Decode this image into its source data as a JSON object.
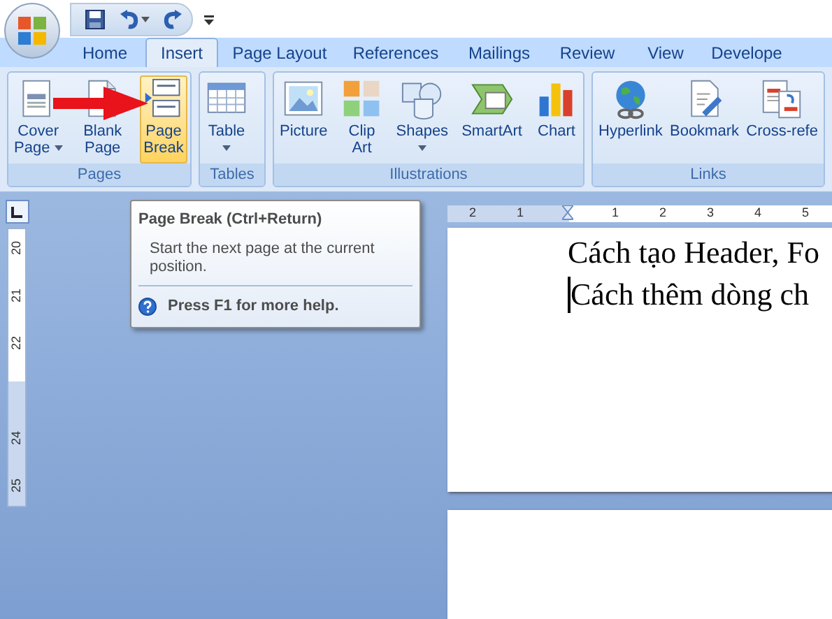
{
  "tabs": [
    {
      "label": "Home",
      "selected": false
    },
    {
      "label": "Insert",
      "selected": true
    },
    {
      "label": "Page Layout",
      "selected": false
    },
    {
      "label": "References",
      "selected": false
    },
    {
      "label": "Mailings",
      "selected": false
    },
    {
      "label": "Review",
      "selected": false
    },
    {
      "label": "View",
      "selected": false
    },
    {
      "label": "Develope",
      "selected": false
    }
  ],
  "ribbon_groups": [
    {
      "label": "Pages",
      "buttons": [
        {
          "lines": [
            "Cover",
            "Page"
          ],
          "dropdown": true,
          "highlighted": false
        },
        {
          "lines": [
            "Blank",
            "Page"
          ],
          "dropdown": false,
          "highlighted": false
        },
        {
          "lines": [
            "Page",
            "Break"
          ],
          "dropdown": false,
          "highlighted": true
        }
      ]
    },
    {
      "label": "Tables",
      "buttons": [
        {
          "lines": [
            "Table"
          ],
          "dropdown": true,
          "highlighted": false
        }
      ]
    },
    {
      "label": "Illustrations",
      "buttons": [
        {
          "lines": [
            "Picture"
          ],
          "dropdown": false,
          "highlighted": false
        },
        {
          "lines": [
            "Clip",
            "Art"
          ],
          "dropdown": false,
          "highlighted": false
        },
        {
          "lines": [
            "Shapes"
          ],
          "dropdown": true,
          "highlighted": false
        },
        {
          "lines": [
            "SmartArt"
          ],
          "dropdown": false,
          "highlighted": false
        },
        {
          "lines": [
            "Chart"
          ],
          "dropdown": false,
          "highlighted": false
        }
      ]
    },
    {
      "label": "Links",
      "buttons": [
        {
          "lines": [
            "Hyperlink"
          ],
          "dropdown": false,
          "highlighted": false
        },
        {
          "lines": [
            "Bookmark"
          ],
          "dropdown": false,
          "highlighted": false
        },
        {
          "lines": [
            "Cross-refe"
          ],
          "dropdown": false,
          "highlighted": false
        }
      ]
    }
  ],
  "tooltip": {
    "title": "Page Break (Ctrl+Return)",
    "body": "Start the next page at the current position.",
    "help": "Press F1 for more help."
  },
  "horizontal_ruler": [
    "2",
    "1",
    "1",
    "2",
    "3",
    "4",
    "5"
  ],
  "vertical_ruler": [
    "20",
    "21",
    "22",
    "24",
    "25"
  ],
  "document_lines": [
    "Cách tạo Header, Fo",
    "Cách thêm dòng ch"
  ]
}
